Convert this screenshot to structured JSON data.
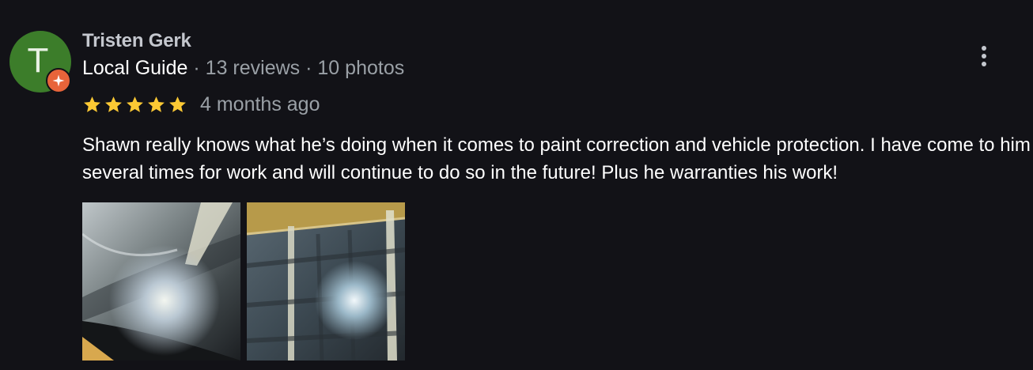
{
  "review": {
    "author": {
      "name": "Tristen Gerk",
      "avatar_letter": "T",
      "avatar_color": "#3c7d2a",
      "badge_icon": "local-guide-star-icon",
      "badge_color": "#e8643a"
    },
    "meta": {
      "guide_label": "Local Guide",
      "separator": "·",
      "reviews_count": "13 reviews",
      "photos_count": "10 photos"
    },
    "rating": {
      "stars": 5,
      "max": 5,
      "star_color": "#fcc934"
    },
    "date": "4 months ago",
    "text": "Shawn really knows what he’s doing when it comes to paint correction and vehicle protection. I have come to him several times for work and will continue to do so in the future! Plus he warranties his work!",
    "more_icon": "more-vertical-icon",
    "photos": [
      {
        "subject": "polished car paint reflecting shop lights"
      },
      {
        "subject": "glossy car body reflecting garage ceiling"
      }
    ]
  }
}
